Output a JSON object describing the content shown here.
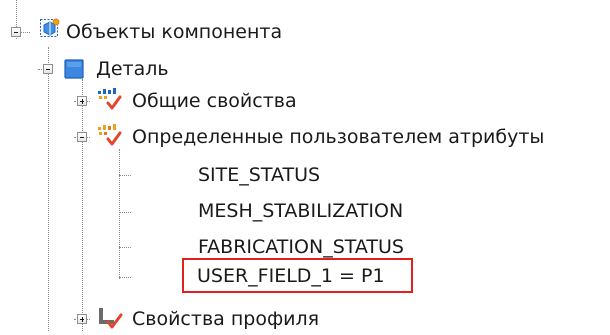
{
  "tree": {
    "root": {
      "label": "Объекты компонента",
      "icon": "component-objects-icon"
    },
    "detail": {
      "label": "Деталь",
      "icon": "part-icon"
    },
    "general_props": {
      "label": "Общие свойства",
      "icon": "properties-icon"
    },
    "user_attributes": {
      "label": "Определенные пользователем атрибуты",
      "icon": "properties-icon"
    },
    "attributes": [
      {
        "label": "SITE_STATUS"
      },
      {
        "label": "MESH_STABILIZATION"
      },
      {
        "label": "FABRICATION_STATUS"
      },
      {
        "label": "USER_FIELD_1 = P1"
      }
    ],
    "profile_props": {
      "label": "Свойства профиля",
      "icon": "profile-icon"
    }
  },
  "colors": {
    "highlight_border": "#e3201b",
    "icon_blue": "#1c65c8",
    "icon_orange": "#f2a01c",
    "check_red": "#e0462f",
    "profile_grey": "#6b6b6b"
  }
}
